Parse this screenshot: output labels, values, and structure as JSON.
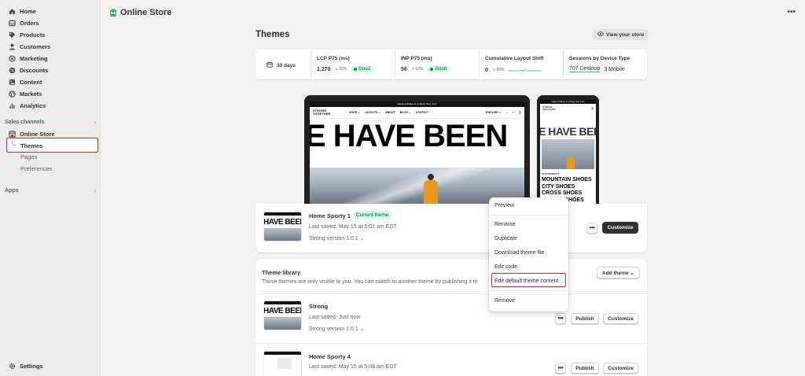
{
  "sidebar": {
    "items": [
      {
        "label": "Home",
        "icon": "home-icon"
      },
      {
        "label": "Orders",
        "icon": "orders-icon"
      },
      {
        "label": "Products",
        "icon": "tag-icon"
      },
      {
        "label": "Customers",
        "icon": "person-icon"
      },
      {
        "label": "Marketing",
        "icon": "target-icon"
      },
      {
        "label": "Discounts",
        "icon": "discount-icon"
      },
      {
        "label": "Content",
        "icon": "content-icon"
      },
      {
        "label": "Markets",
        "icon": "globe-icon"
      },
      {
        "label": "Analytics",
        "icon": "chart-icon"
      }
    ],
    "sales_channels_label": "Sales channels",
    "online_store_label": "Online Store",
    "sub_items": {
      "themes": "Themes",
      "pages": "Pages",
      "preferences": "Preferences"
    },
    "apps_label": "Apps",
    "settings_label": "Settings"
  },
  "topbar": {
    "title": "Online Store"
  },
  "page": {
    "title": "Themes",
    "view_store": "View your store"
  },
  "metrics": {
    "days": "30 days",
    "lcp": {
      "label": "LCP P75 (ms)",
      "value": "1,270",
      "change": "↘ 32%",
      "status": "Good"
    },
    "inp": {
      "label": "INP P75 (ms)",
      "value": "56",
      "change": "↗ 12%",
      "status": "Good"
    },
    "cls": {
      "label": "Cumulative Layout Shift",
      "value": "0",
      "change": "↘ 50%"
    },
    "sessions": {
      "label": "Sessions by Device Type",
      "desktop": "707 Desktop",
      "mobile": "3 Mobile"
    }
  },
  "preview": {
    "promo": "Happy Holidays & a Happy New Year!",
    "logo_line1": "STRONG",
    "logo_line2": "TOGETHER",
    "nav": [
      "SHOP ⌄",
      "LAYOUTS ⌄",
      "ABOUT",
      "BLOG ⌄",
      "CONTACT"
    ],
    "lang": "ENGLISH ⌄",
    "hero": "E HAVE BEEN",
    "phone_section": "OUR PRODUCT",
    "phone_list": [
      "MOUNTAIN SHOES",
      "CITY SHOES",
      "CROSS SHOES",
      "TRAVEL SHOES"
    ]
  },
  "current_theme": {
    "name": "Home Sporty 1",
    "badge": "Current theme",
    "saved": "Last saved: May 15 at 5:02 am EDT",
    "version": "Strong version 1.0.1 ⌄",
    "thumb_text": "HAVE BEEN L",
    "customize": "Customize",
    "more": "•••"
  },
  "library": {
    "title": "Theme library",
    "description": "These themes are only visible to you. You can switch to another theme by publishing it to",
    "add_theme": "Add theme ⌄",
    "themes": [
      {
        "name": "Strong",
        "saved": "Last saved: Just now",
        "version": "Strong version 1.0.1 ⌄",
        "thumb_text": "HAVE BEEN",
        "publish": "Publish",
        "customize": "Customize",
        "more": "•••"
      },
      {
        "name": "Home Sporty 4",
        "saved": "Last saved: May 15 at 5:08 am EDT",
        "version": "",
        "thumb_text": "",
        "publish": "Publish",
        "customize": "Customize",
        "more": "•••"
      }
    ]
  },
  "context_menu": {
    "items": [
      "Preview",
      "Rename",
      "Duplicate",
      "Download theme file",
      "Edit code",
      "Edit default theme content",
      "Remove"
    ]
  },
  "colors": {
    "highlight_red": "#d72c0d",
    "good_green": "#29845a",
    "brand_green": "#36a852"
  }
}
